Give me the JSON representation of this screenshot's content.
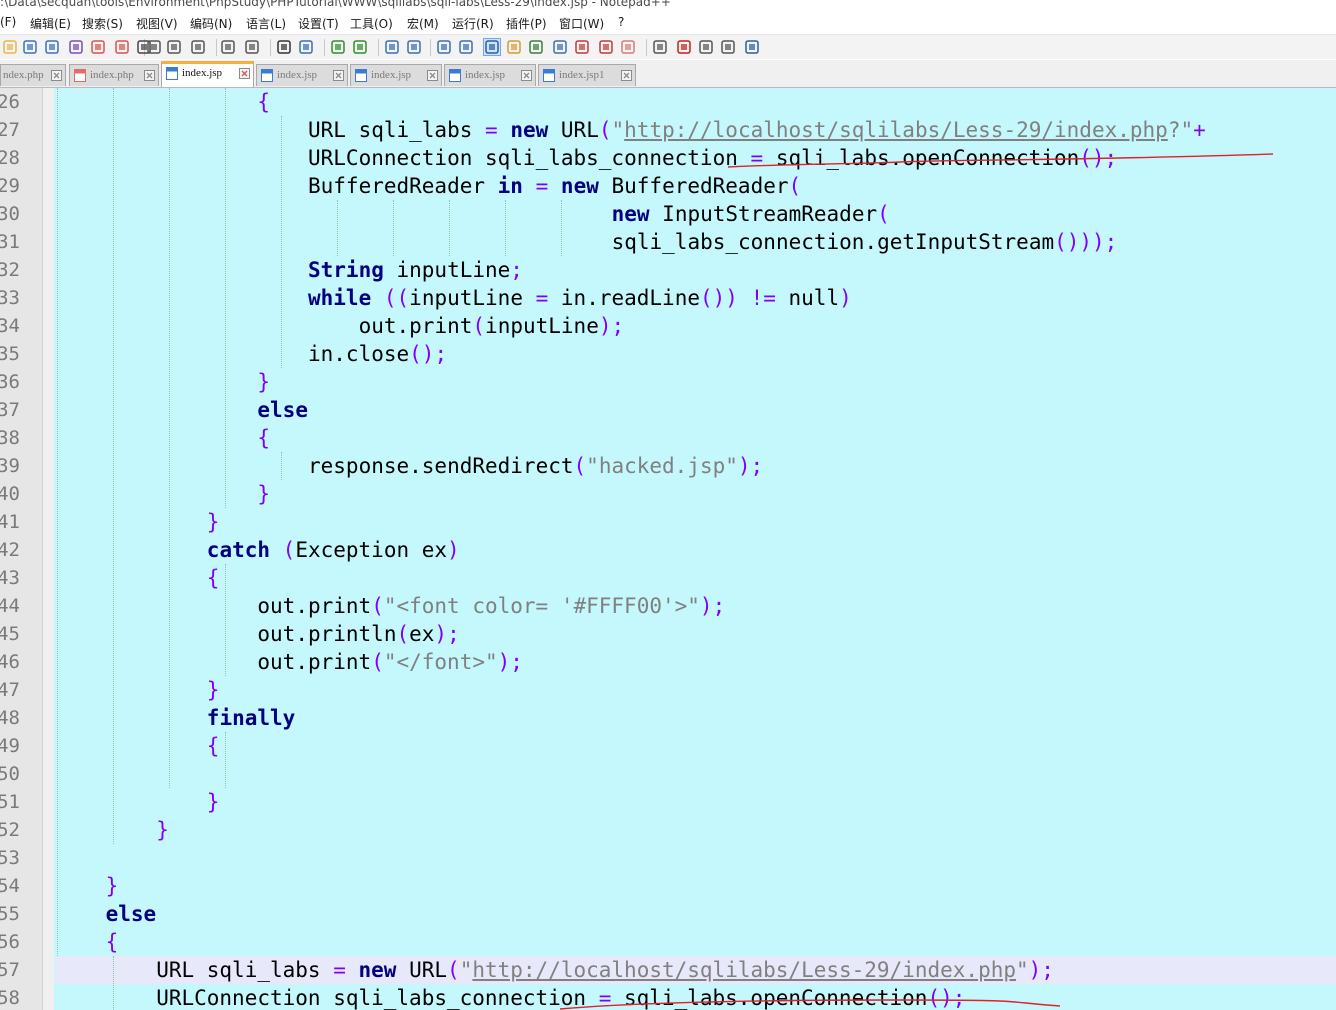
{
  "window": {
    "title": ":\\Data\\secquan\\tools\\Environment\\PhpStudy\\PHPTutorial\\WWW\\sqlilabs\\sqli-labs\\Less-29\\index.jsp - Notepad++"
  },
  "menu": {
    "items": [
      "(F)",
      "编辑(E)",
      "搜索(S)",
      "视图(V)",
      "编码(N)",
      "语言(L)",
      "设置(T)",
      "工具(O)",
      "宏(M)",
      "运行(R)",
      "插件(P)",
      "窗口(W)",
      "?"
    ]
  },
  "toolbar": {
    "buttons": [
      "new-icon",
      "open-icon",
      "save-icon",
      "save-all-icon",
      "close-icon",
      "close-all-icon",
      "print-icon",
      "cut-icon",
      "copy-icon",
      "paste-icon",
      "undo-icon",
      "redo-icon",
      "find-icon",
      "replace-icon",
      "zoom-in-icon",
      "zoom-out-icon",
      "sync-vertical-icon",
      "sync-horizontal-icon",
      "word-wrap-icon",
      "show-all-chars-icon",
      "indent-guide-icon",
      "document-map-icon",
      "function-list-icon",
      "folder-workspace-icon",
      "document-list-icon",
      "monitoring-icon",
      "folder-icon",
      "view-icon",
      "record-macro-icon",
      "stop-macro-icon",
      "play-macro-icon",
      "run-macro-multiple-icon",
      "save-macro-icon"
    ]
  },
  "tabs": [
    {
      "label": "ndex.php",
      "icon": "file-icon",
      "color": "#e06c6c"
    },
    {
      "label": "index.php",
      "icon": "file-icon",
      "color": "#e06c6c"
    },
    {
      "label": "index.jsp",
      "icon": "file-icon",
      "color": "#3a7bd5",
      "active": true
    },
    {
      "label": "index.jsp",
      "icon": "file-icon",
      "color": "#3a7bd5"
    },
    {
      "label": "index.jsp",
      "icon": "file-icon",
      "color": "#3a7bd5"
    },
    {
      "label": "index.jsp",
      "icon": "file-icon",
      "color": "#3a7bd5"
    },
    {
      "label": "index.jsp1",
      "icon": "file-icon",
      "color": "#3a7bd5"
    }
  ],
  "editor": {
    "background": "#c4f8fc",
    "current_line_background": "#e8e8fb",
    "current_line_number": "57",
    "line_numbers": [
      "26",
      "27",
      "28",
      "29",
      "30",
      "31",
      "32",
      "33",
      "34",
      "35",
      "36",
      "37",
      "38",
      "39",
      "40",
      "41",
      "42",
      "43",
      "44",
      "45",
      "46",
      "47",
      "48",
      "49",
      "50",
      "51",
      "52",
      "53",
      "54",
      "55",
      "56",
      "57",
      "58"
    ],
    "lines": [
      [
        {
          "t": "{",
          "c": "op"
        }
      ],
      [
        {
          "t": "URL sqli_labs ",
          "c": "id"
        },
        {
          "t": "=",
          "c": "op"
        },
        {
          "t": " ",
          "c": "id"
        },
        {
          "t": "new",
          "c": "kw"
        },
        {
          "t": " URL",
          "c": "id"
        },
        {
          "t": "(",
          "c": "op"
        },
        {
          "t": "\"",
          "c": "str"
        },
        {
          "t": "http://localhost/sqlilabs/Less-29/index.php",
          "c": "url"
        },
        {
          "t": "?\"",
          "c": "str"
        },
        {
          "t": "+",
          "c": "op"
        }
      ],
      [
        {
          "t": "URLConnection sqli_labs_connection ",
          "c": "id"
        },
        {
          "t": "=",
          "c": "op"
        },
        {
          "t": " sqli_labs.openConnection",
          "c": "id"
        },
        {
          "t": "();",
          "c": "op"
        }
      ],
      [
        {
          "t": "BufferedReader ",
          "c": "id"
        },
        {
          "t": "in",
          "c": "kw"
        },
        {
          "t": " ",
          "c": "id"
        },
        {
          "t": "=",
          "c": "op"
        },
        {
          "t": " ",
          "c": "id"
        },
        {
          "t": "new",
          "c": "kw"
        },
        {
          "t": " BufferedReader",
          "c": "id"
        },
        {
          "t": "(",
          "c": "op"
        }
      ],
      [
        {
          "t": "new",
          "c": "kw"
        },
        {
          "t": " InputStreamReader",
          "c": "id"
        },
        {
          "t": "(",
          "c": "op"
        }
      ],
      [
        {
          "t": "sqli_labs_connection.getInputStream",
          "c": "id"
        },
        {
          "t": "()));",
          "c": "op"
        }
      ],
      [
        {
          "t": "String",
          "c": "kw"
        },
        {
          "t": " inputLine",
          "c": "id"
        },
        {
          "t": ";",
          "c": "op"
        }
      ],
      [
        {
          "t": "while",
          "c": "kw"
        },
        {
          "t": " ",
          "c": "id"
        },
        {
          "t": "((",
          "c": "op"
        },
        {
          "t": "inputLine ",
          "c": "id"
        },
        {
          "t": "=",
          "c": "op"
        },
        {
          "t": " in.readLine",
          "c": "id"
        },
        {
          "t": "())",
          "c": "op"
        },
        {
          "t": " ",
          "c": "id"
        },
        {
          "t": "!=",
          "c": "op"
        },
        {
          "t": " null",
          "c": "id"
        },
        {
          "t": ")",
          "c": "op"
        }
      ],
      [
        {
          "t": "out.print",
          "c": "id"
        },
        {
          "t": "(",
          "c": "op"
        },
        {
          "t": "inputLine",
          "c": "id"
        },
        {
          "t": ");",
          "c": "op"
        }
      ],
      [
        {
          "t": "in.close",
          "c": "id"
        },
        {
          "t": "();",
          "c": "op"
        }
      ],
      [
        {
          "t": "}",
          "c": "op"
        }
      ],
      [
        {
          "t": "else",
          "c": "kw"
        }
      ],
      [
        {
          "t": "{",
          "c": "op"
        }
      ],
      [
        {
          "t": "response.sendRedirect",
          "c": "id"
        },
        {
          "t": "(",
          "c": "op"
        },
        {
          "t": "\"hacked.jsp\"",
          "c": "str"
        },
        {
          "t": ");",
          "c": "op"
        }
      ],
      [
        {
          "t": "}",
          "c": "op"
        }
      ],
      [
        {
          "t": "}",
          "c": "op"
        }
      ],
      [
        {
          "t": "catch",
          "c": "kw"
        },
        {
          "t": " ",
          "c": "id"
        },
        {
          "t": "(",
          "c": "op"
        },
        {
          "t": "Exception ex",
          "c": "id"
        },
        {
          "t": ")",
          "c": "op"
        }
      ],
      [
        {
          "t": "{",
          "c": "op"
        }
      ],
      [
        {
          "t": "out.print",
          "c": "id"
        },
        {
          "t": "(",
          "c": "op"
        },
        {
          "t": "\"<font color= '#FFFF00'>\"",
          "c": "str"
        },
        {
          "t": ");",
          "c": "op"
        }
      ],
      [
        {
          "t": "out.println",
          "c": "id"
        },
        {
          "t": "(",
          "c": "op"
        },
        {
          "t": "ex",
          "c": "id"
        },
        {
          "t": ");",
          "c": "op"
        }
      ],
      [
        {
          "t": "out.print",
          "c": "id"
        },
        {
          "t": "(",
          "c": "op"
        },
        {
          "t": "\"</font>\"",
          "c": "str"
        },
        {
          "t": ");",
          "c": "op"
        }
      ],
      [
        {
          "t": "}",
          "c": "op"
        }
      ],
      [
        {
          "t": "finally",
          "c": "kw"
        }
      ],
      [
        {
          "t": "{",
          "c": "op"
        }
      ],
      [],
      [
        {
          "t": "}",
          "c": "op"
        }
      ],
      [
        {
          "t": "}",
          "c": "op"
        }
      ],
      [],
      [
        {
          "t": "}",
          "c": "op"
        }
      ],
      [
        {
          "t": "else",
          "c": "kw"
        }
      ],
      [
        {
          "t": "{",
          "c": "op"
        }
      ],
      [
        {
          "t": "URL sqli_labs ",
          "c": "id"
        },
        {
          "t": "=",
          "c": "op"
        },
        {
          "t": " ",
          "c": "id"
        },
        {
          "t": "new",
          "c": "kw"
        },
        {
          "t": " URL",
          "c": "id"
        },
        {
          "t": "(",
          "c": "op"
        },
        {
          "t": "\"",
          "c": "str"
        },
        {
          "t": "http://localhost/sqlilabs/Less-29/index.php",
          "c": "url"
        },
        {
          "t": "\"",
          "c": "str"
        },
        {
          "t": ");",
          "c": "op"
        }
      ],
      [
        {
          "t": "URLConnection sqli_labs_connection ",
          "c": "id"
        },
        {
          "t": "=",
          "c": "op"
        },
        {
          "t": " sqli_labs.openConnection",
          "c": "id"
        },
        {
          "t": "();",
          "c": "op"
        }
      ]
    ]
  }
}
